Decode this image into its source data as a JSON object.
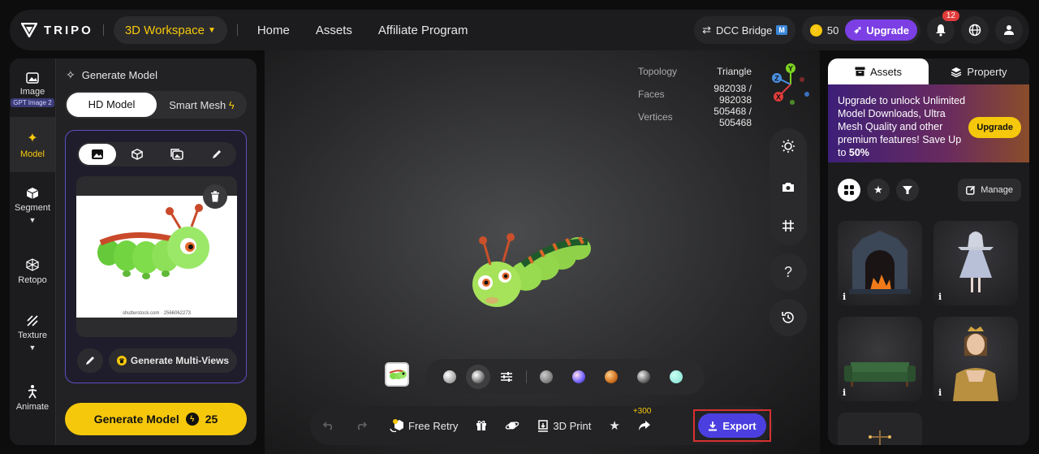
{
  "header": {
    "brand": "TRIPO",
    "workspace": "3D Workspace",
    "nav": [
      "Home",
      "Assets",
      "Affiliate Program"
    ],
    "dcc_bridge": "DCC Bridge",
    "dcc_badge": "M",
    "credits": "50",
    "upgrade": "Upgrade",
    "notification_count": "12"
  },
  "rail": {
    "items": [
      {
        "label": "Image",
        "badge": "GPT Image 2"
      },
      {
        "label": "Model"
      },
      {
        "label": "Segment"
      },
      {
        "label": "Retopo"
      },
      {
        "label": "Texture"
      },
      {
        "label": "Animate"
      }
    ]
  },
  "generate": {
    "title": "Generate Model",
    "mode_hd": "HD Model",
    "mode_smart": "Smart Mesh",
    "watermark": "shutterstock.com · 2566062273",
    "multi_views": "Generate Multi-Views",
    "button_label": "Generate Model",
    "cost": "25"
  },
  "stats": {
    "topology_label": "Topology",
    "topology_value": "Triangle",
    "faces_label": "Faces",
    "faces_value": "982038 / 982038",
    "vertices_label": "Vertices",
    "vertices_value": "505468 / 505468"
  },
  "axes": {
    "x": "X",
    "y": "Y",
    "z": "Z"
  },
  "tools": {
    "help": "?"
  },
  "materials": {
    "colors": [
      "#8a8a8a",
      "#7a6cff",
      "#e08a20",
      "#9a9a9a",
      "#7fe0d0"
    ]
  },
  "actions": {
    "free_retry": "Free Retry",
    "print": "3D Print",
    "bonus": "+300",
    "export": "Export"
  },
  "right_panel": {
    "tab_assets": "Assets",
    "tab_property": "Property",
    "promo_line": "Upgrade to unlock Unlimited Model Downloads, Ultra Mesh Quality and other premium features!  Save Up to ",
    "promo_highlight": "50%",
    "promo_button": "Upgrade",
    "manage": "Manage",
    "info_glyph": "i"
  }
}
